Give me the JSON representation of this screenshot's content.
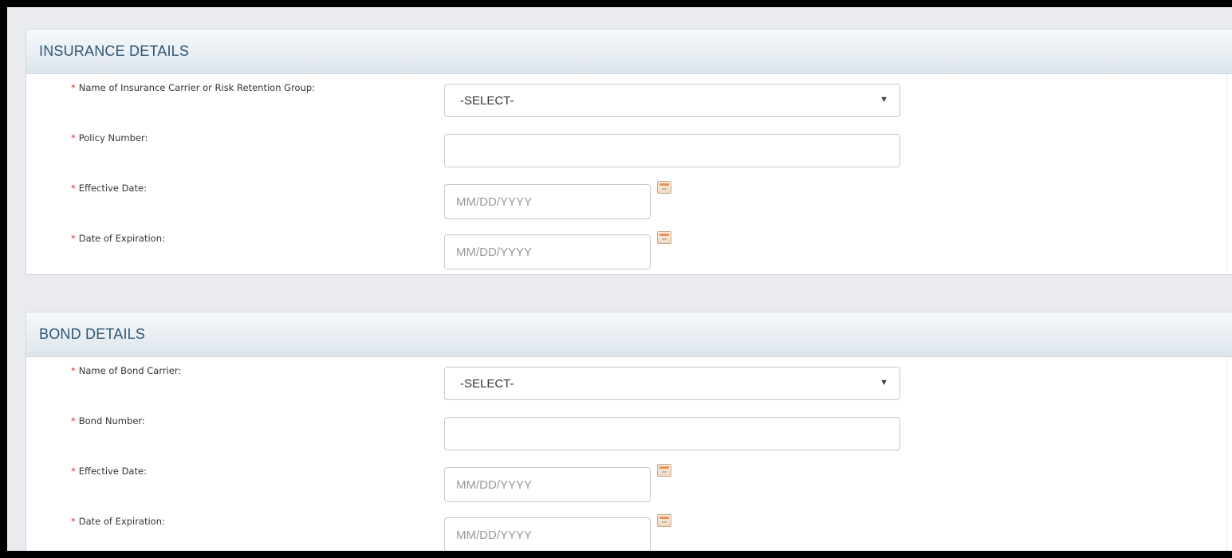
{
  "insurance": {
    "title": "INSURANCE DETAILS",
    "carrier_label": "Name of Insurance Carrier or Risk Retention Group:",
    "carrier_value": "-SELECT-",
    "policy_label": "Policy Number:",
    "policy_value": "",
    "effective_label": "Effective Date:",
    "effective_placeholder": "MM/DD/YYYY",
    "expiration_label": "Date of Expiration:",
    "expiration_placeholder": "MM/DD/YYYY"
  },
  "bond": {
    "title": "BOND DETAILS",
    "carrier_label": "Name of Bond Carrier:",
    "carrier_value": "-SELECT-",
    "number_label": "Bond Number:",
    "number_value": "",
    "effective_label": "Effective Date:",
    "effective_placeholder": "MM/DD/YYYY",
    "expiration_label": "Date of Expiration:",
    "expiration_placeholder": "MM/DD/YYYY"
  },
  "common": {
    "required_marker": "*",
    "dropdown_caret": "▼"
  },
  "colors": {
    "section_title": "#2f5673",
    "required": "#d9322b",
    "background": "#e9ebef"
  }
}
